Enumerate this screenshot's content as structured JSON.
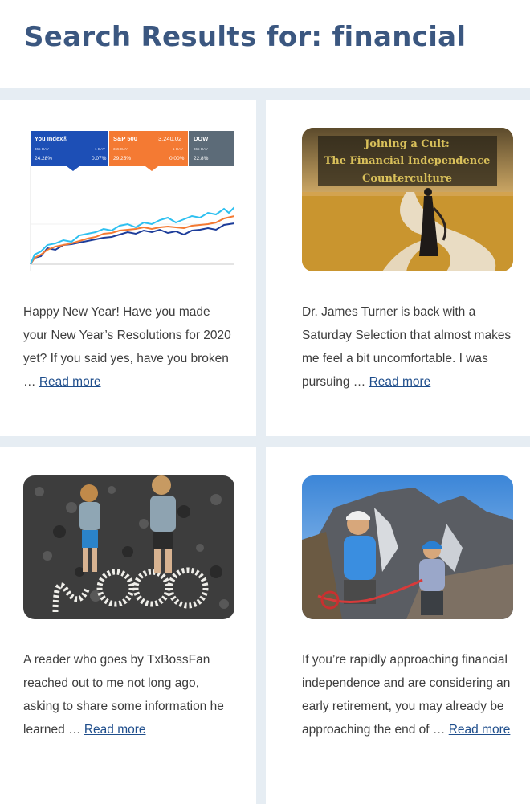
{
  "page": {
    "title": "Search Results for: financial"
  },
  "posts": [
    {
      "excerpt": "Happy New Year! Have you made your New Year’s Resolutions for 2020 yet? If you said yes, have you broken …",
      "read_more": "Read more",
      "image": {
        "type": "index-chart",
        "tabs": [
          {
            "name": "You Index®",
            "period": "365-DAY",
            "change_label": "1-DAY",
            "value": "24.28%",
            "change": "0.07%",
            "color": "#1d4fb6"
          },
          {
            "name": "S&P 500",
            "price": "3,240.02",
            "period": "365-DAY",
            "change_label": "1-DAY",
            "value": "29.25%",
            "change": "0.00%",
            "color": "#f47a33"
          },
          {
            "name": "DOW",
            "period": "365-DAY",
            "value": "22.8%",
            "color": "#5c6b78"
          }
        ]
      }
    },
    {
      "excerpt": "Dr. James Turner is back with a Saturday Selection that almost makes me feel a bit uncomfortable. I was pursuing …",
      "read_more": "Read more",
      "image": {
        "type": "photo-with-caption",
        "caption_line1": "Joining a Cult:",
        "caption_line2": "The Financial Independence",
        "caption_line3": "Counterculture"
      }
    },
    {
      "excerpt": "A reader who goes by TxBossFan reached out to me not long ago, asking to share some information he learned …",
      "read_more": "Read more",
      "image": {
        "type": "photo",
        "subject": "kids-on-pebbles"
      }
    },
    {
      "excerpt": "If you’re rapidly approaching financial independence and are considering an early retirement, you may already be approaching the end of …",
      "read_more": "Read more",
      "image": {
        "type": "photo",
        "subject": "climbers-on-mountain"
      }
    }
  ]
}
